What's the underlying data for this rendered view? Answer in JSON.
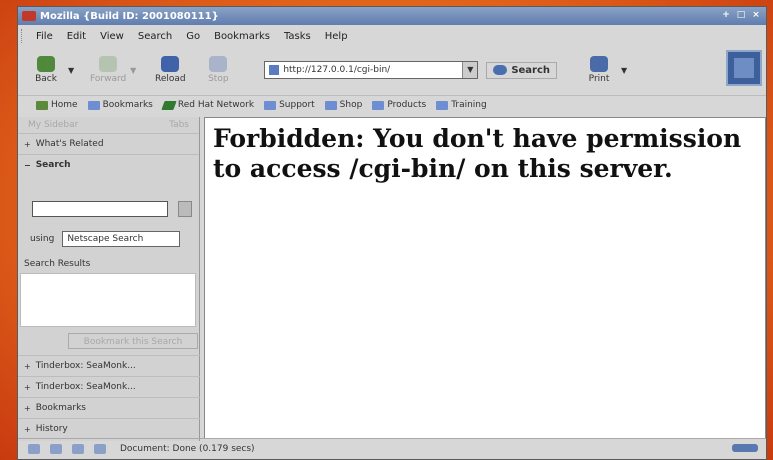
{
  "window": {
    "title": "Mozilla {Build ID: 2001080111}"
  },
  "titlebar_buttons": [
    "+",
    "□",
    "×"
  ],
  "menu": [
    "File",
    "Edit",
    "View",
    "Search",
    "Go",
    "Bookmarks",
    "Tasks",
    "Help"
  ],
  "nav": {
    "back": "Back",
    "forward": "Forward",
    "reload": "Reload",
    "stop": "Stop",
    "url": "http://127.0.0.1/cgi-bin/",
    "search": "Search",
    "print": "Print"
  },
  "personal_toolbar": [
    "Home",
    "Bookmarks",
    "Red Hat Network",
    "Support",
    "Shop",
    "Products",
    "Training"
  ],
  "sidebar": {
    "title": "My Sidebar",
    "tabs": "Tabs",
    "whats_related": "What's Related",
    "search": "Search",
    "using_label": "using",
    "engine": "Netscape Search",
    "results_label": "Search Results",
    "bookmark_button": "Bookmark this Search",
    "panels": [
      "Tinderbox: SeaMonk...",
      "Tinderbox: SeaMonk...",
      "Bookmarks",
      "History"
    ]
  },
  "content": {
    "heading": "Forbidden: You don't have permission to access /cgi-bin/ on this server."
  },
  "status": {
    "text": "Document: Done (0.179 secs)"
  },
  "colors": {
    "accent": "#5f7dae",
    "background": "#e8701e"
  }
}
